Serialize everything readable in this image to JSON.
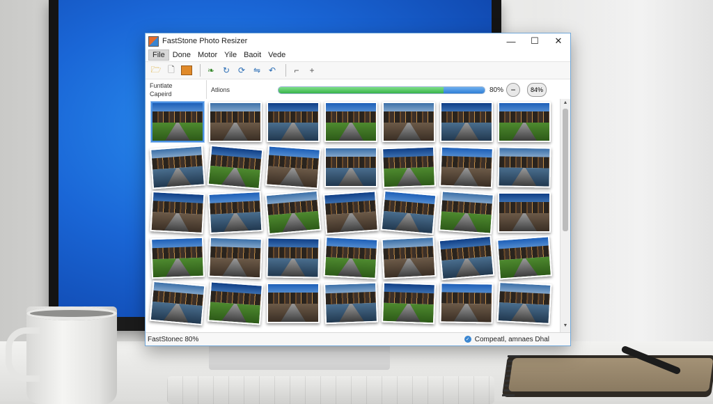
{
  "window": {
    "title": "FastStone Photo Resizer",
    "minimize": "—",
    "maximize": "☐",
    "close": "✕"
  },
  "menu": [
    "File",
    "Done",
    "Motor",
    "Yile",
    "Baoit",
    "Vede"
  ],
  "toolbar": {
    "buttons": [
      "open-folder-icon",
      "new-file-icon",
      "box-icon",
      "leaf-icon",
      "rotate-icon",
      "refresh-icon",
      "flip-icon",
      "undo-icon",
      "crop-icon",
      "plus-icon"
    ]
  },
  "infobar": {
    "source_line1": "Funtlate",
    "source_line2": "Capeird",
    "actions_label": "Atlions",
    "progress_percent": 80,
    "percent_label": "80%",
    "zoom_out": "−",
    "zoom_value": "84%"
  },
  "status": {
    "left": "FastStonec 80%",
    "right": "Compeatl, amnaes Dhal"
  },
  "thumbnails": {
    "rows": 5,
    "cols": 7,
    "selected_index": 0
  },
  "colors": {
    "accent": "#4a90e2",
    "progress_green": "#38b34a",
    "progress_blue": "#2f7fd6",
    "window_border": "#6fa6d8"
  }
}
